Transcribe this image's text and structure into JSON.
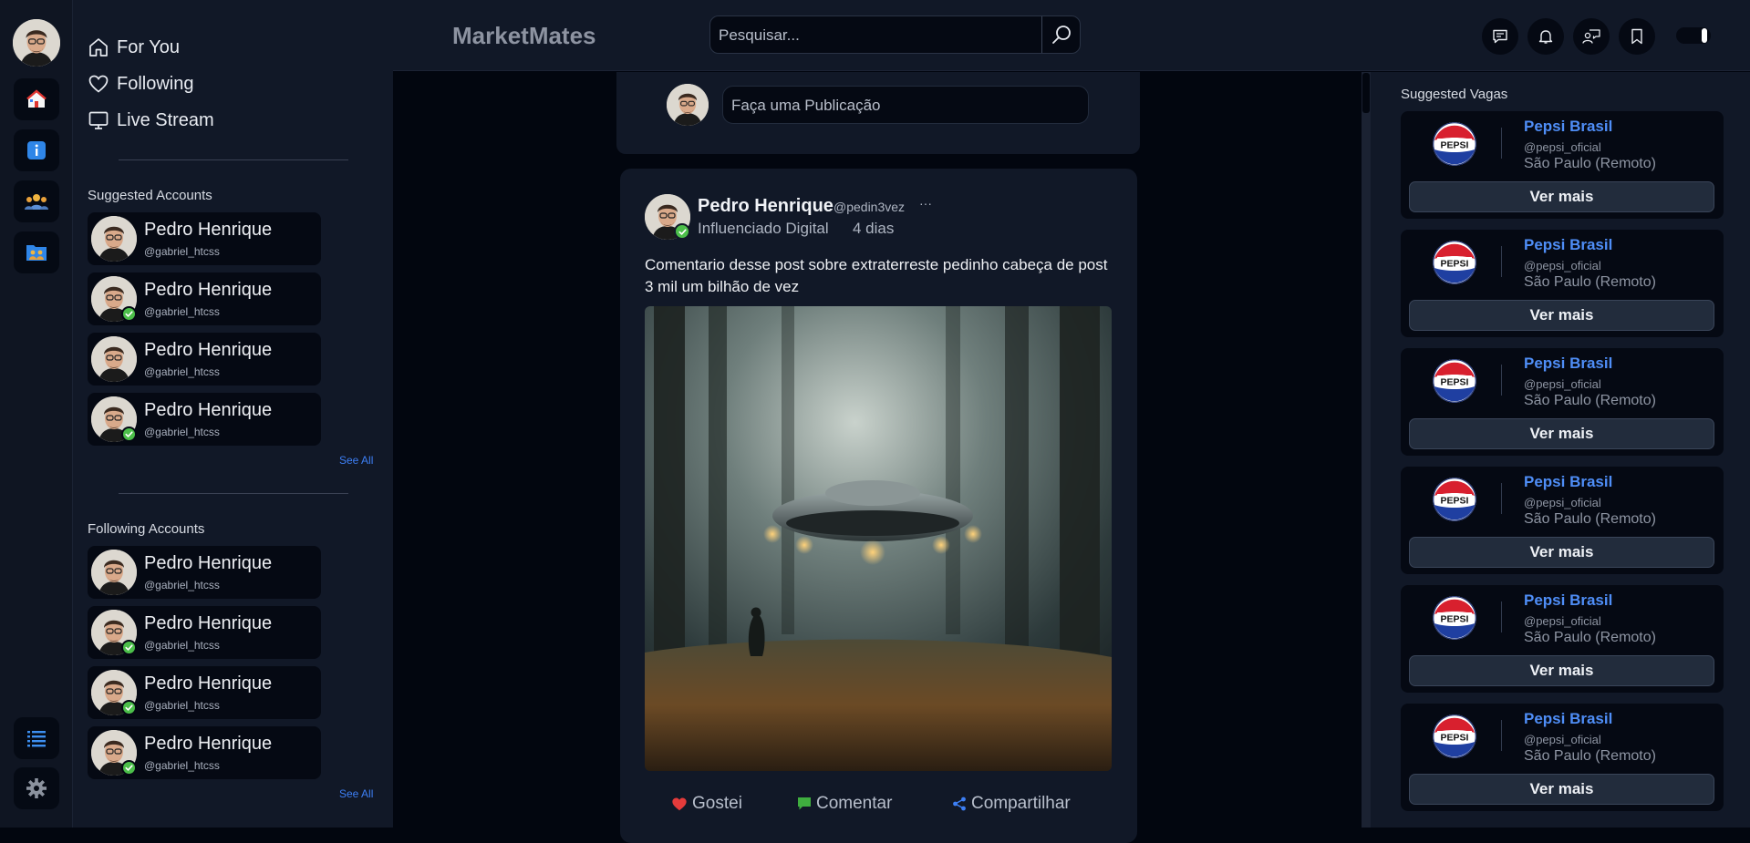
{
  "app": {
    "title": "MarketMates"
  },
  "header": {
    "search_placeholder": "Pesquisar...",
    "icons": [
      "chat-icon",
      "bell-icon",
      "users-chat-icon",
      "bookmark-icon",
      "theme-toggle"
    ]
  },
  "rail": {
    "items": [
      "home-icon",
      "info-icon",
      "groups-icon",
      "folder-people-icon",
      "list-icon",
      "settings-icon"
    ]
  },
  "nav": {
    "items": [
      {
        "label": "For You",
        "icon": "home-icon"
      },
      {
        "label": "Following",
        "icon": "heart-icon"
      },
      {
        "label": "Live Stream",
        "icon": "monitor-icon"
      }
    ]
  },
  "suggested_accounts": {
    "title": "Suggested Accounts",
    "see_all": "See All",
    "items": [
      {
        "name": "Pedro Henrique",
        "handle": "@gabriel_htcss",
        "verified": false
      },
      {
        "name": "Pedro Henrique",
        "handle": "@gabriel_htcss",
        "verified": true
      },
      {
        "name": "Pedro Henrique",
        "handle": "@gabriel_htcss",
        "verified": false
      },
      {
        "name": "Pedro Henrique",
        "handle": "@gabriel_htcss",
        "verified": true
      }
    ]
  },
  "following_accounts": {
    "title": "Following Accounts",
    "see_all": "See All",
    "items": [
      {
        "name": "Pedro Henrique",
        "handle": "@gabriel_htcss",
        "verified": false
      },
      {
        "name": "Pedro Henrique",
        "handle": "@gabriel_htcss",
        "verified": true
      },
      {
        "name": "Pedro Henrique",
        "handle": "@gabriel_htcss",
        "verified": true
      },
      {
        "name": "Pedro Henrique",
        "handle": "@gabriel_htcss",
        "verified": true
      }
    ]
  },
  "composer": {
    "placeholder": "Faça uma Publicação"
  },
  "post": {
    "author": "Pedro Henrique",
    "handle": "@pedin3vez",
    "more": "···",
    "role": "Influenciado Digital",
    "time": "4 dias",
    "text": "Comentario desse post sobre extraterreste pedinho cabeça de post 3 mil um bilhão de vez",
    "actions": [
      {
        "label": "Gostei",
        "icon": "heart-icon",
        "color": "#e53b3b"
      },
      {
        "label": "Comentar",
        "icon": "comment-icon",
        "color": "#3fae3f"
      },
      {
        "label": "Compartilhar",
        "icon": "share-icon",
        "color": "#3d7ff5"
      }
    ]
  },
  "jobs": {
    "title": "Suggested Vagas",
    "items": [
      {
        "company": "Pepsi Brasil",
        "handle": "@pepsi_oficial",
        "location": "São Paulo (Remoto)",
        "button": "Ver mais",
        "logo_text": "PEPSI"
      },
      {
        "company": "Pepsi Brasil",
        "handle": "@pepsi_oficial",
        "location": "São Paulo (Remoto)",
        "button": "Ver mais",
        "logo_text": "PEPSI"
      },
      {
        "company": "Pepsi Brasil",
        "handle": "@pepsi_oficial",
        "location": "São Paulo (Remoto)",
        "button": "Ver mais",
        "logo_text": "PEPSI"
      },
      {
        "company": "Pepsi Brasil",
        "handle": "@pepsi_oficial",
        "location": "São Paulo (Remoto)",
        "button": "Ver mais",
        "logo_text": "PEPSI"
      },
      {
        "company": "Pepsi Brasil",
        "handle": "@pepsi_oficial",
        "location": "São Paulo (Remoto)",
        "button": "Ver mais",
        "logo_text": "PEPSI"
      },
      {
        "company": "Pepsi Brasil",
        "handle": "@pepsi_oficial",
        "location": "São Paulo (Remoto)",
        "button": "Ver mais",
        "logo_text": "PEPSI"
      }
    ]
  },
  "colors": {
    "accent": "#3d7ff5",
    "verified": "#4cbf4a",
    "bg": "#02060f",
    "panel": "#111827"
  }
}
